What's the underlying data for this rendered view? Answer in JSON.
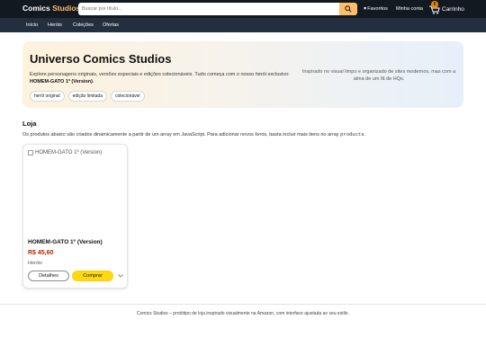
{
  "header": {
    "logo_part1": "Comics",
    "logo_part2": "Studios",
    "search_placeholder": "Buscar por título...",
    "favorites_label": "Favoritos",
    "account_label": "Minha conta",
    "cart_label": "Carrinho",
    "cart_count": "0"
  },
  "subnav": {
    "items": [
      "Início",
      "Heróis",
      "Coleções",
      "Ofertas"
    ]
  },
  "hero": {
    "title": "Universo Comics Studios",
    "description": "Explore personagens originais, versões especiais e edições colecionáveis. Tudo começa com o nosso herói exclusivo:",
    "highlight": "HOMEM-GATO 1º (Version)",
    "highlight_suffix": ".",
    "tags": [
      "herói original",
      "edição limitada",
      "colecionável"
    ],
    "aside": "Inspirado no visual limpo e organizado de sites modernos, mas com a alma de um fã de HQs."
  },
  "store": {
    "title": "Loja",
    "description_prefix": "Os produtos abaixo são criados dinamicamente a partir de um array em JavaScript. Para adicionar novos livros, basta incluir mais itens no array",
    "description_code": "products",
    "description_suffix": "."
  },
  "products": [
    {
      "image_alt": "HOMEM-GATO 1º (Version)",
      "title": "HOMEM-GATO 1º (Version)",
      "price": "R$ 45,60",
      "category": "Heróis",
      "details_label": "Detalhes",
      "buy_label": "Comprar"
    }
  ],
  "footer": {
    "text": "Comics Studios – protótipo de loja inspirado visualmente na Amazon, com interface ajustada ao seu estilo."
  },
  "colors": {
    "topbar": "#131921",
    "subnav": "#232f3e",
    "accent": "#febd69",
    "buy_button": "#ffd814",
    "price": "#b12704"
  },
  "icons": [
    "search-icon",
    "heart-icon",
    "cart-icon",
    "chevron-down-icon",
    "broken-image-icon"
  ]
}
